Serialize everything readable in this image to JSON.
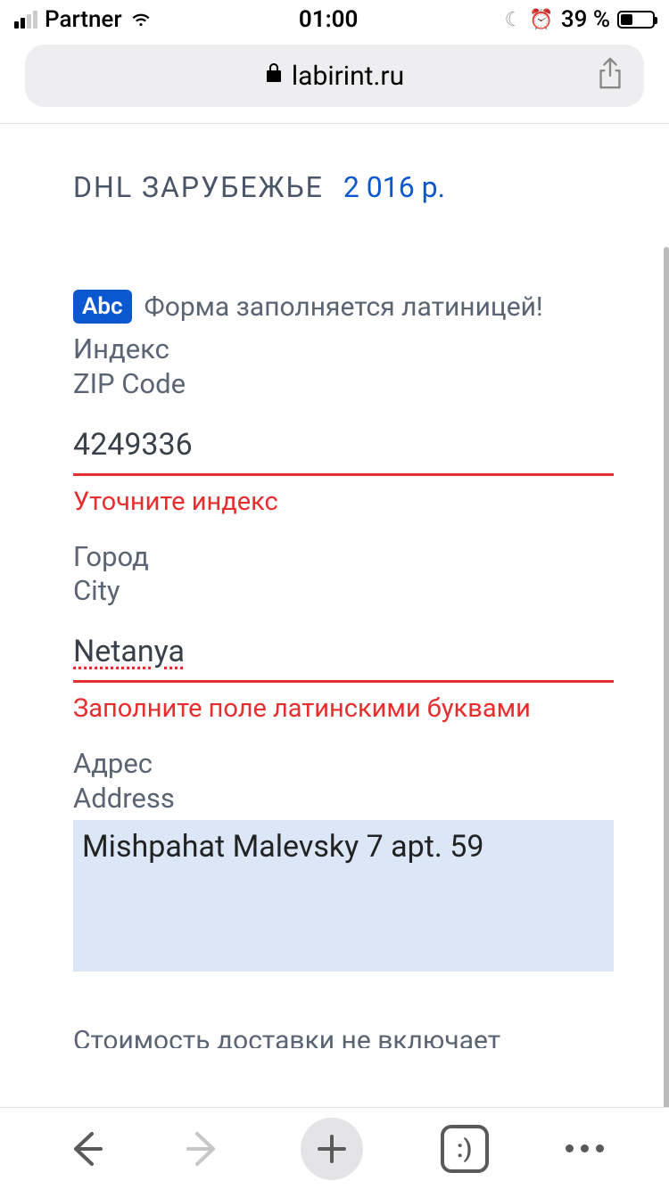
{
  "status": {
    "carrier": "Partner",
    "time": "01:00",
    "battery_pct": "39 %"
  },
  "url_bar": {
    "domain": "labirint.ru"
  },
  "shipping": {
    "method": "DHL ЗАРУБЕЖЬЕ",
    "price": "2 016 р."
  },
  "notice": {
    "badge": "Abc",
    "text": "Форма заполняется латиницей!"
  },
  "form": {
    "zip": {
      "label_ru": "Индекс",
      "label_en": "ZIP Code",
      "value": "4249336",
      "error": "Уточните индекс"
    },
    "city": {
      "label_ru": "Город",
      "label_en": "City",
      "value": "Netanya",
      "error": "Заполните поле латинскими буквами"
    },
    "address": {
      "label_ru": "Адрес",
      "label_en": "Address",
      "value": "Mishpahat Malevsky 7 apt. 59"
    }
  },
  "footer_partial": "Стоимость доставки не включает",
  "tabs": {
    "indicator": ":)"
  }
}
